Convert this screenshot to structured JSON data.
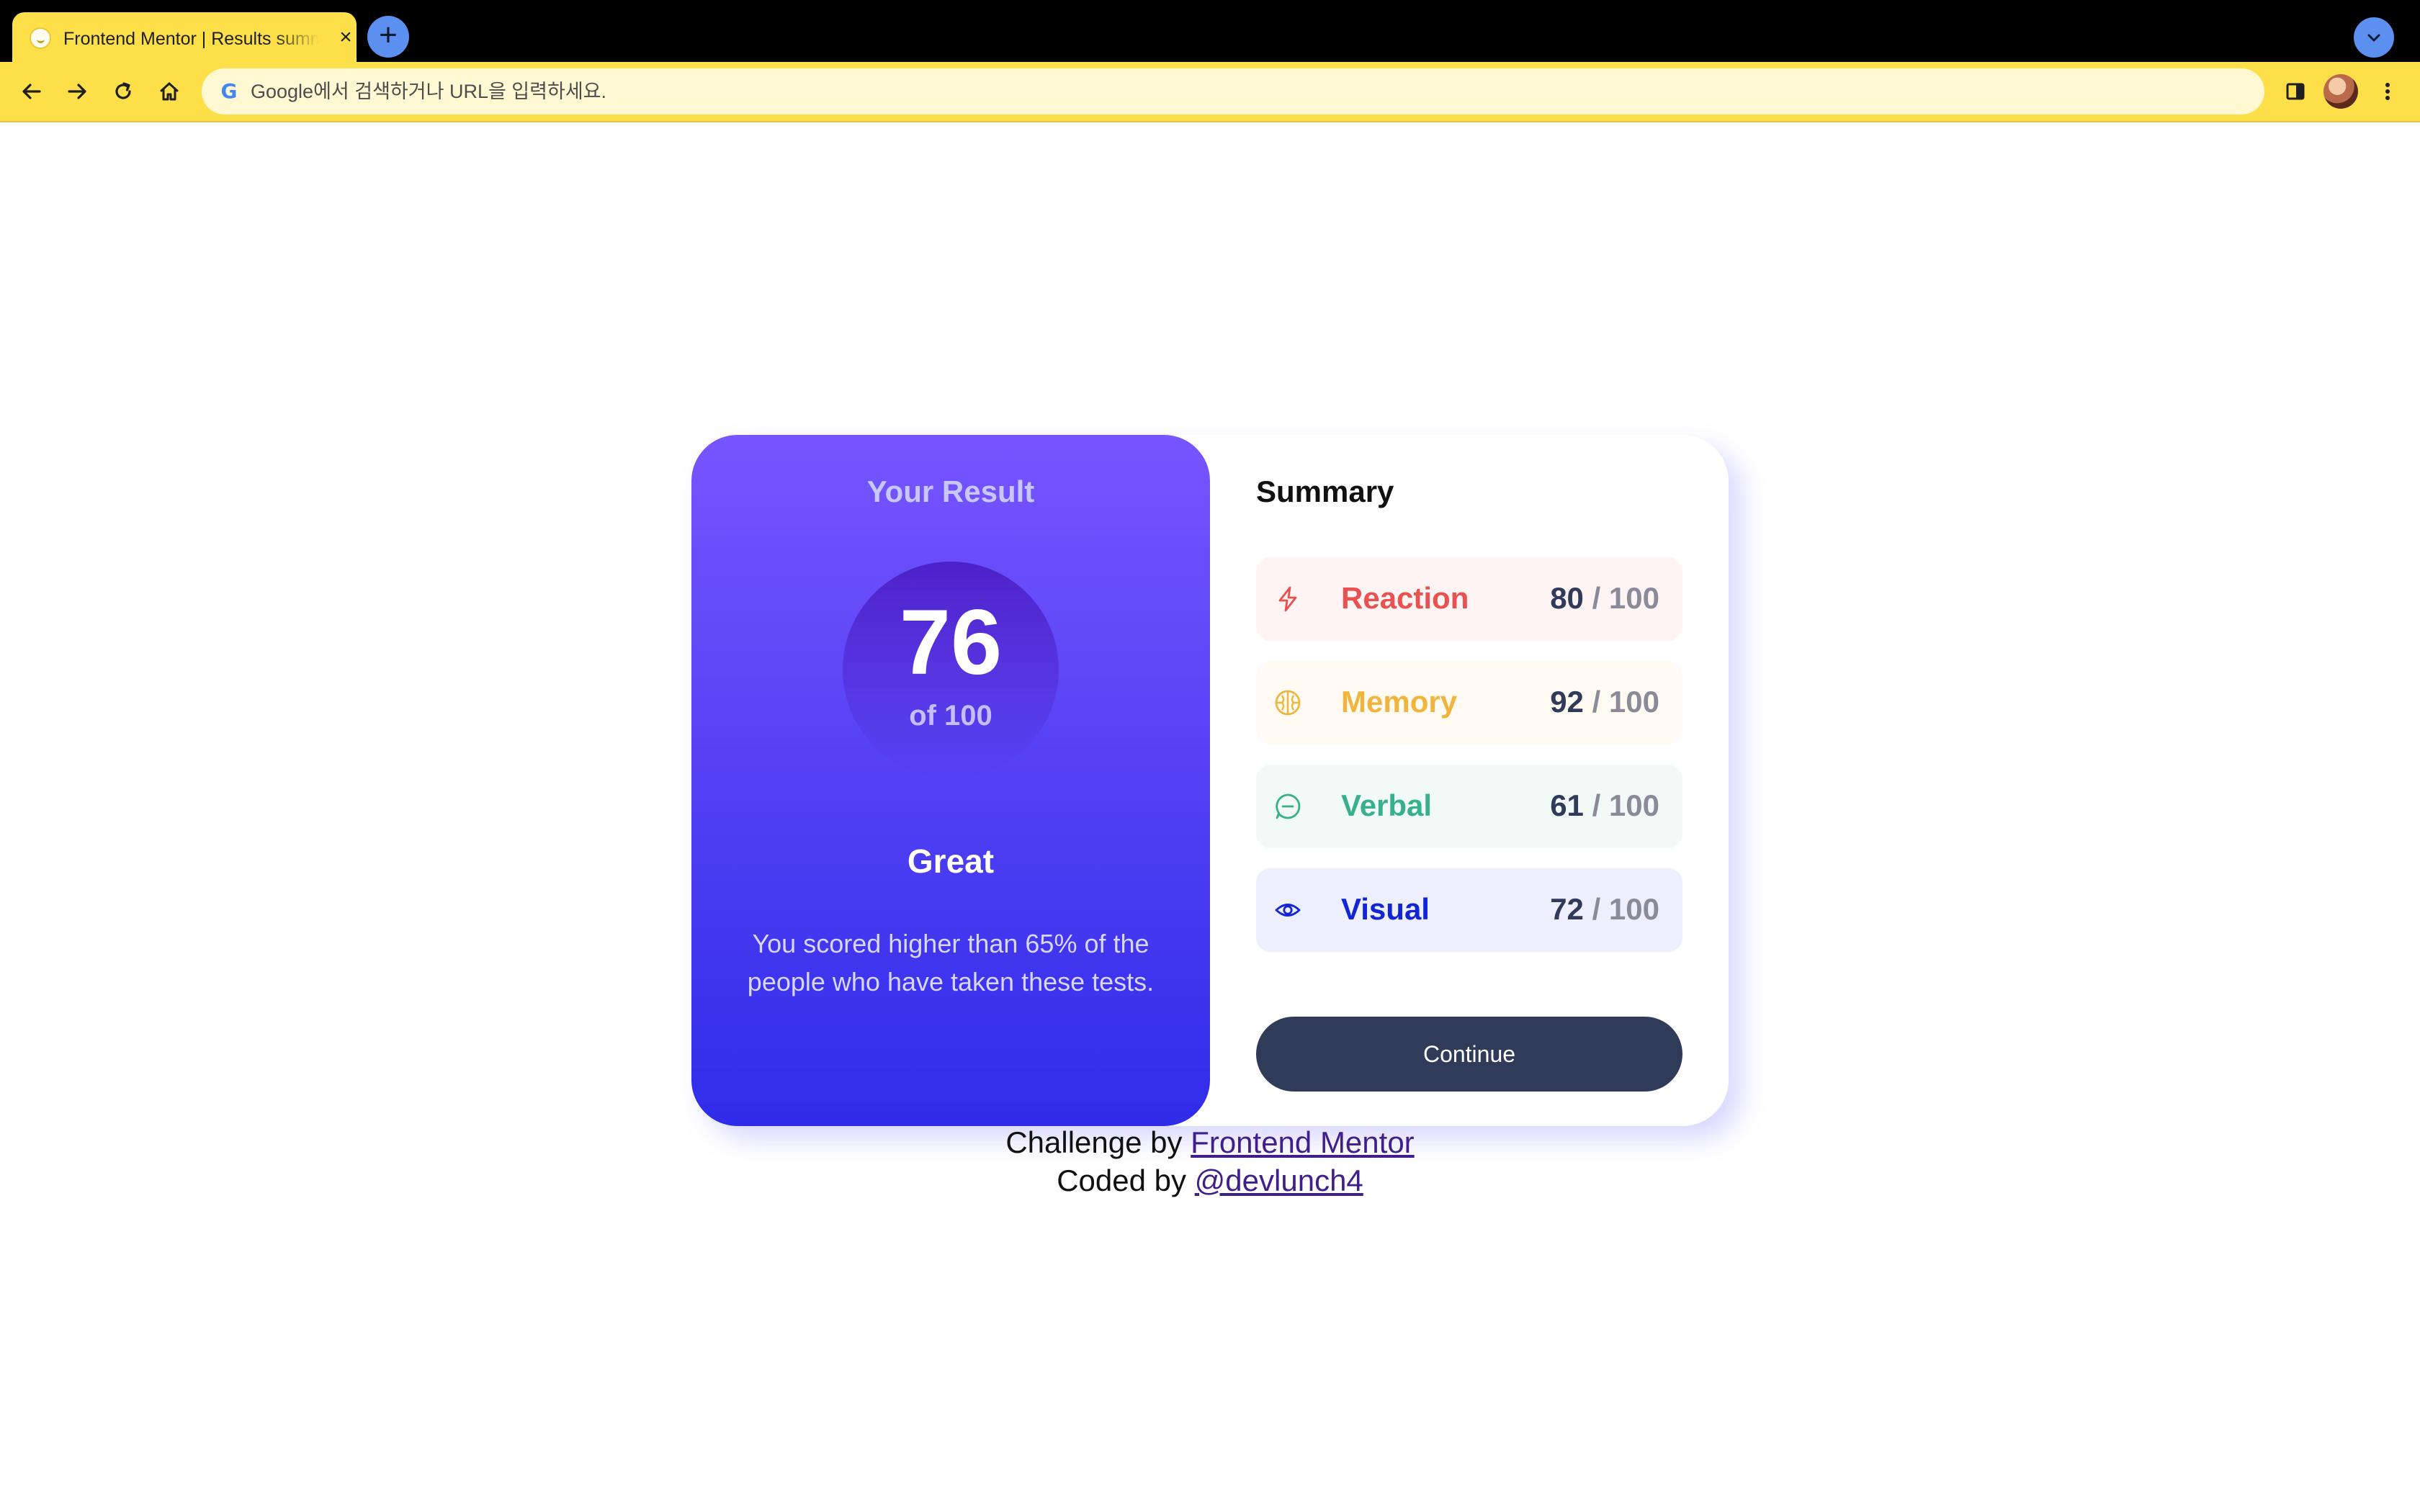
{
  "browser": {
    "tab_title": "Frontend Mentor | Results summary component",
    "tab_close": "×",
    "new_tab": "+",
    "address_placeholder": "Google에서 검색하거나 URL을 입력하세요.",
    "google_glyph": "G"
  },
  "result": {
    "heading": "Your Result",
    "score": "76",
    "out_of": "of 100",
    "rating": "Great",
    "description": "You scored higher than 65% of the people who have taken these tests."
  },
  "summary": {
    "title": "Summary",
    "items": [
      {
        "label": "Reaction",
        "score": "80",
        "max": "/ 100",
        "icon": "lightning-icon",
        "color": "#ea5252",
        "bg": "#fef4f4"
      },
      {
        "label": "Memory",
        "score": "92",
        "max": "/ 100",
        "icon": "brain-icon",
        "color": "#f1b43d",
        "bg": "#fffbf3"
      },
      {
        "label": "Verbal",
        "score": "61",
        "max": "/ 100",
        "icon": "chat-bubble-icon",
        "color": "#36b18b",
        "bg": "#f2faf8"
      },
      {
        "label": "Visual",
        "score": "72",
        "max": "/ 100",
        "icon": "eye-icon",
        "color": "#1125d6",
        "bg": "#eeeffc"
      }
    ],
    "continue_label": "Continue"
  },
  "attribution": {
    "challenge_prefix": "Challenge by",
    "challenge_link": "Frontend Mentor",
    "coded_prefix": "Coded by",
    "coded_link": "@devlunch4"
  }
}
